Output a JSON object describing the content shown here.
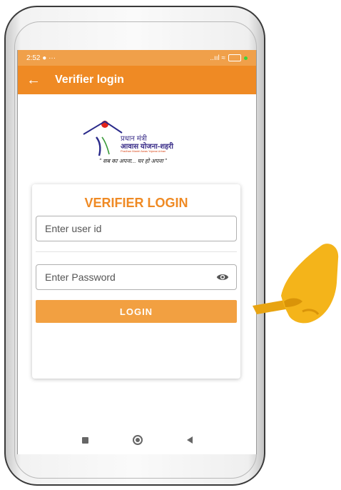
{
  "status_bar": {
    "time": "2:52",
    "extra": "● ···",
    "signal": "..ııl ≈"
  },
  "app_bar": {
    "back_glyph": "←",
    "title": "Verifier login"
  },
  "logo": {
    "line1": "प्रधान मंत्री",
    "line2": "आवास योजना-शहरी",
    "line3": "Pradhan Mantri Awas Yojana-Urban",
    "tagline": "\" सब का अपना... घर हो अपना \""
  },
  "login_card": {
    "title": "VERIFIER LOGIN",
    "user_id_placeholder": "Enter user id",
    "password_placeholder": "Enter Password",
    "login_button": "LOGIN"
  },
  "colors": {
    "accent": "#ef8a24",
    "status_bar": "#f0a04a",
    "button": "#f2a041",
    "title": "#ef8a24"
  },
  "icons": {
    "back": "arrow-left-icon",
    "eye": "eye-icon",
    "recents": "square-icon",
    "home": "circle-icon",
    "nav_back": "triangle-icon"
  }
}
